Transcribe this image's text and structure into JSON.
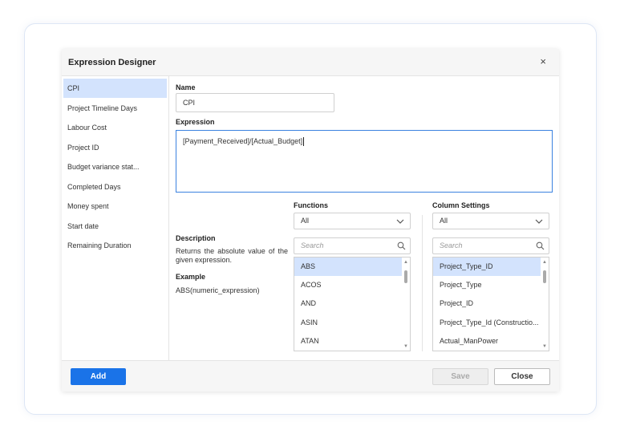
{
  "dialog": {
    "title": "Expression Designer",
    "close_glyph": "×"
  },
  "sidebar": {
    "items": [
      {
        "label": "CPI"
      },
      {
        "label": "Project Timeline Days"
      },
      {
        "label": "Labour Cost"
      },
      {
        "label": "Project ID"
      },
      {
        "label": "Budget variance stat..."
      },
      {
        "label": "Completed Days"
      },
      {
        "label": "Money spent"
      },
      {
        "label": "Start date"
      },
      {
        "label": "Remaining Duration"
      }
    ]
  },
  "form": {
    "name_label": "Name",
    "name_value": "CPI",
    "expression_label": "Expression",
    "expression_value": "[Payment_Received]/[Actual_Budget]"
  },
  "help": {
    "description_label": "Description",
    "description_text": "Returns the absolute value of the given expression.",
    "example_label": "Example",
    "example_text": "ABS(numeric_expression)"
  },
  "functions": {
    "label": "Functions",
    "selected": "All",
    "search_placeholder": "Search",
    "items": [
      "ABS",
      "ACOS",
      "AND",
      "ASIN",
      "ATAN"
    ]
  },
  "columns": {
    "label": "Column Settings",
    "selected": "All",
    "search_placeholder": "Search",
    "items": [
      "Project_Type_ID",
      "Project_Type",
      "Project_ID",
      "Project_Type_Id (Constructio...",
      "Actual_ManPower"
    ]
  },
  "footer": {
    "add_label": "Add",
    "save_label": "Save",
    "close_label": "Close"
  },
  "colors": {
    "accent": "#1a73e8",
    "selection": "#d3e3fd",
    "focus_border": "#3b82e0"
  },
  "icons": [
    "close-icon",
    "chevron-down-icon",
    "search-icon"
  ]
}
